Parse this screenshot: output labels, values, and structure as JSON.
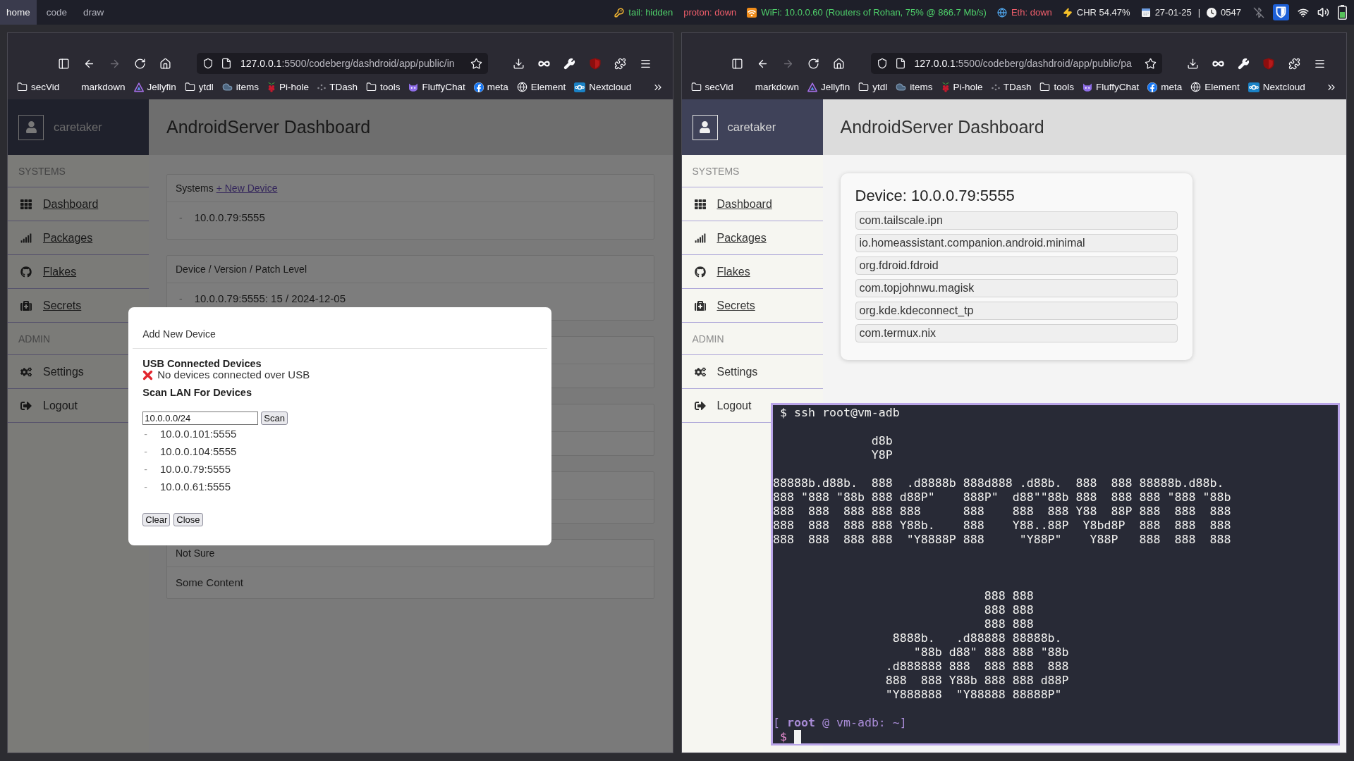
{
  "top_bar": {
    "workspaces": [
      {
        "label": "home",
        "selected": true
      },
      {
        "label": "code",
        "selected": false
      },
      {
        "label": "draw",
        "selected": false
      }
    ],
    "status": [
      {
        "kind": "tailscale",
        "text": "tail: hidden",
        "color": "#4fd06b"
      },
      {
        "kind": "vpn",
        "text": "proton: down",
        "color": "#f25f6c"
      },
      {
        "kind": "wifi",
        "text": "WiFi: 10.0.0.60 (Routers of Rohan, 75% @ 866.7 Mb/s)",
        "color": "#4fd06b"
      },
      {
        "kind": "ethernet",
        "text": "Eth: down",
        "color": "#f25f6c"
      },
      {
        "kind": "battery",
        "text": "CHR 54.47%",
        "color": "#e6e6e6"
      },
      {
        "kind": "date",
        "text": "27-01-25",
        "color": "#e6e6e6"
      },
      {
        "kind": "separator",
        "text": "|",
        "color": "#e6e6e6"
      },
      {
        "kind": "time",
        "text": "0547",
        "color": "#e6e6e6"
      }
    ]
  },
  "windows": [
    {
      "url": {
        "host": "127.0.0.1",
        "path": ":5500/codeberg/dashdroid/app/public/in"
      },
      "forward_disabled": true,
      "bookmarks": [
        {
          "kind": "folder",
          "label": "secVid"
        },
        {
          "kind": "plain",
          "label": "markdown"
        },
        {
          "kind": "jellyfin",
          "label": "Jellyfin"
        },
        {
          "kind": "folder",
          "label": "ytdl"
        },
        {
          "kind": "cloud",
          "label": "items"
        },
        {
          "kind": "raspberry",
          "label": "Pi-hole"
        },
        {
          "kind": "dots",
          "label": "TDash"
        },
        {
          "kind": "folder",
          "label": "tools"
        },
        {
          "kind": "cat",
          "label": "FluffyChat"
        },
        {
          "kind": "facebook",
          "label": "meta"
        },
        {
          "kind": "globe",
          "label": "Element"
        },
        {
          "kind": "nextcloud",
          "label": "Nextcloud"
        }
      ],
      "page": {
        "user": "caretaker",
        "title": "AndroidServer Dashboard",
        "sidebar": [
          {
            "label": "SYSTEMS",
            "items": [
              {
                "kind": "dashboard",
                "label": "Dashboard",
                "link": true
              },
              {
                "kind": "packages",
                "label": "Packages",
                "link": true
              },
              {
                "kind": "flakes",
                "label": "Flakes",
                "link": true
              },
              {
                "kind": "secrets",
                "label": "Secrets",
                "link": true
              }
            ]
          },
          {
            "label": "ADMIN",
            "items": [
              {
                "kind": "settings",
                "label": "Settings",
                "link": false
              },
              {
                "kind": "logout",
                "label": "Logout",
                "link": false
              }
            ]
          }
        ],
        "cards": [
          {
            "kind": "list",
            "title": "Systems",
            "link": "+ New Device",
            "rows": [
              {
                "bullet": "-",
                "text": "10.0.0.79:5555"
              }
            ]
          },
          {
            "kind": "list",
            "title": "Device / Version / Patch Level",
            "rows": [
              {
                "bullet": "-",
                "text": "10.0.0.79:5555: 15 / 2024-12-05"
              }
            ]
          },
          {
            "kind": "covered"
          },
          {
            "kind": "covered"
          },
          {
            "kind": "covered"
          },
          {
            "kind": "text",
            "title": "Not Sure",
            "body": "Some Content"
          }
        ],
        "modal": {
          "title": "Add New Device",
          "usb_heading": "USB Connected Devices",
          "usb_status": {
            "kind": "error",
            "text": "No devices connected over USB"
          },
          "scan_heading": "Scan LAN For Devices",
          "scan_field": {
            "value": "10.0.0.0/24"
          },
          "scan_button": "Scan",
          "results": [
            {
              "bullet": "-",
              "text": "10.0.0.101:5555"
            },
            {
              "bullet": "-",
              "text": "10.0.0.104:5555"
            },
            {
              "bullet": "-",
              "text": "10.0.0.79:5555"
            },
            {
              "bullet": "-",
              "text": "10.0.0.61:5555"
            }
          ],
          "buttons": [
            "Clear",
            "Close"
          ]
        }
      }
    },
    {
      "url": {
        "host": "127.0.0.1",
        "path": ":5500/codeberg/dashdroid/app/public/pa"
      },
      "forward_disabled": true,
      "bookmarks": [
        {
          "kind": "folder",
          "label": "secVid"
        },
        {
          "kind": "plain",
          "label": "markdown"
        },
        {
          "kind": "jellyfin",
          "label": "Jellyfin"
        },
        {
          "kind": "folder",
          "label": "ytdl"
        },
        {
          "kind": "cloud",
          "label": "items"
        },
        {
          "kind": "raspberry",
          "label": "Pi-hole"
        },
        {
          "kind": "dots",
          "label": "TDash"
        },
        {
          "kind": "folder",
          "label": "tools"
        },
        {
          "kind": "cat",
          "label": "FluffyChat"
        },
        {
          "kind": "facebook",
          "label": "meta"
        },
        {
          "kind": "globe",
          "label": "Element"
        },
        {
          "kind": "nextcloud",
          "label": "Nextcloud"
        }
      ],
      "page": {
        "user": "caretaker",
        "title": "AndroidServer Dashboard",
        "sidebar": [
          {
            "label": "SYSTEMS",
            "items": [
              {
                "kind": "dashboard",
                "label": "Dashboard",
                "link": true
              },
              {
                "kind": "packages",
                "label": "Packages",
                "link": true
              },
              {
                "kind": "flakes",
                "label": "Flakes",
                "link": true
              },
              {
                "kind": "secrets",
                "label": "Secrets",
                "link": true
              }
            ]
          },
          {
            "label": "ADMIN",
            "items": [
              {
                "kind": "settings",
                "label": "Settings",
                "link": false
              },
              {
                "kind": "logout",
                "label": "Logout",
                "link": false
              }
            ]
          }
        ],
        "device_card": {
          "title": "Device: 10.0.0.79:5555",
          "packages": [
            "com.tailscale.ipn",
            "io.homeassistant.companion.android.minimal",
            "org.fdroid.fdroid",
            "com.topjohnwu.magisk",
            "org.kde.kdeconnect_tp",
            "com.termux.nix"
          ]
        }
      }
    }
  ],
  "terminal": {
    "command": "$ ssh root@vm-adb",
    "title_art": "              d8b\n              Y8P\n\n88888b.d88b.  888  .d8888b 888d888 .d88b.  888  888 88888b.d88b.\n888 \"888 \"88b 888 d88P\"    888P\"  d88\"\"88b 888  888 888 \"888 \"88b\n888  888  888 888 888      888    888  888 Y88  88P 888  888  888\n888  888  888 888 Y88b.    888    Y88..88P  Y8bd8P  888  888  888\n888  888  888 888  \"Y8888P 888     \"Y88P\"    Y88P   888  888  888",
    "logo_art": "              888 888\n              888 888\n              888 888\n 8888b.   .d88888 88888b.\n    \"88b d88\" 888 888 \"88b\n.d888888 888  888 888  888\n888  888 Y88b 888 888 d88P\n\"Y888888  \"Y88888 88888P\"",
    "prompt": "[ **root** @ vm-adb: ~]",
    "input_symbol": "$",
    "cursor": true
  }
}
